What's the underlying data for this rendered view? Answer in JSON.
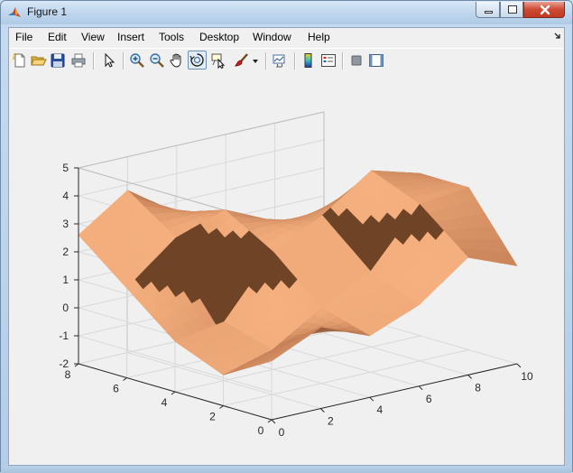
{
  "window": {
    "title": "Figure 1"
  },
  "menu": {
    "items": [
      "File",
      "Edit",
      "View",
      "Insert",
      "Tools",
      "Desktop",
      "Window",
      "Help"
    ]
  },
  "toolbar": {
    "buttons": [
      {
        "name": "new-figure",
        "icon": "new-file-icon"
      },
      {
        "name": "open-file",
        "icon": "folder-open-icon"
      },
      {
        "name": "save-figure",
        "icon": "floppy-disk-icon"
      },
      {
        "name": "print-figure",
        "icon": "printer-icon"
      },
      {
        "name": "edit-plot",
        "icon": "arrow-pointer-icon"
      },
      {
        "name": "zoom-in",
        "icon": "zoom-in-icon"
      },
      {
        "name": "zoom-out",
        "icon": "zoom-out-icon"
      },
      {
        "name": "pan",
        "icon": "hand-icon"
      },
      {
        "name": "rotate-3d",
        "icon": "rotate-icon",
        "active": true
      },
      {
        "name": "data-cursor",
        "icon": "data-cursor-icon"
      },
      {
        "name": "brush",
        "icon": "brush-icon"
      },
      {
        "name": "link-plot",
        "icon": "link-plot-icon"
      },
      {
        "name": "insert-colorbar",
        "icon": "colorbar-icon"
      },
      {
        "name": "insert-legend",
        "icon": "legend-icon"
      },
      {
        "name": "hide-plot-tools",
        "icon": "hide-tools-icon"
      },
      {
        "name": "show-plot-tools",
        "icon": "show-tools-icon"
      }
    ]
  },
  "colors": {
    "surface_base": "#c9845a",
    "surface_highlight": "#f6b07f",
    "surface_shadow": "#6f4326",
    "axis_line": "#262626",
    "grid": "#d9d9d9"
  },
  "chart_data": {
    "type": "surface",
    "title": "",
    "xlabel": "",
    "ylabel": "",
    "zlabel": "",
    "xlim": [
      0,
      10
    ],
    "ylim": [
      0,
      8
    ],
    "zlim": [
      -2,
      5
    ],
    "x_ticks": [
      "0",
      "2",
      "4",
      "6",
      "8",
      "10"
    ],
    "y_ticks": [
      "0",
      "2",
      "4",
      "6",
      "8"
    ],
    "z_ticks": [
      "-2",
      "-1",
      "0",
      "1",
      "2",
      "3",
      "4",
      "5"
    ],
    "grid": true,
    "colormap": "copper",
    "shading": "interp",
    "surface": {
      "x": [
        0,
        2,
        4,
        6,
        8,
        10
      ],
      "y": [
        0,
        2,
        4,
        6,
        8
      ],
      "z": [
        [
          0.1,
          0.9,
          0.2,
          0.9,
          2.2,
          1.5
        ],
        [
          -0.9,
          -0.4,
          0.7,
          1.6,
          3.6,
          3.8
        ],
        [
          -0.2,
          0.1,
          2.2,
          3.1,
          4.3,
          3.8
        ],
        [
          1.2,
          2.6,
          3.2,
          2.4,
          1.8,
          1.6
        ],
        [
          2.6,
          3.8,
          2.6,
          1.4,
          0.4,
          0.1
        ]
      ]
    }
  }
}
